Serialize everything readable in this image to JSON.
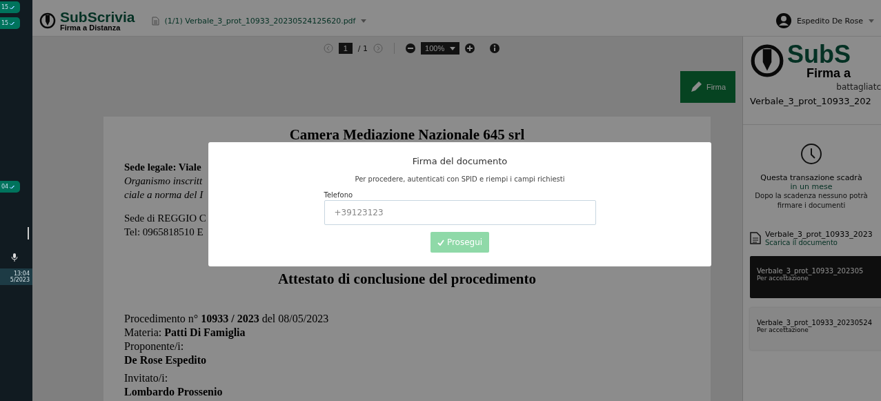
{
  "chat_strip": {
    "bubbles": [
      {
        "time": "15"
      },
      {
        "time": "15"
      },
      {
        "time": "04"
      }
    ],
    "clock": {
      "time": "13:04",
      "date": "5/2023"
    }
  },
  "header": {
    "brand": "SubScrivia",
    "tagline": "Firma a Distanza",
    "file": "(1/1) Verbale_3_prot_10933_20230524125620.pdf",
    "user": "Espedito De Rose"
  },
  "toolbar": {
    "page": "1",
    "page_total": "/ 1",
    "zoom": "100%"
  },
  "sign_button": "Firma",
  "document": {
    "title": "Camera Mediazione Nazionale 645 srl",
    "header_lines": [
      {
        "text": "Sede legale: Viale",
        "kind": "bold"
      },
      {
        "text": "Organismo inscritt",
        "kind": "italic"
      },
      {
        "text": "ciale a norma del I",
        "kind": "italic"
      },
      {
        "text": "Sede di REGGIO C",
        "kind": "gap"
      },
      {
        "text": "Tel: 0965818510 E",
        "kind": "plain"
      }
    ],
    "heading": "Attestato di conclusione del procedimento",
    "body_lines": [
      {
        "text": "Procedimento n° **10933 / 2023** del 08/05/2023",
        "kind": "plain"
      },
      {
        "text": "Materia: **Patti Di Famiglia**",
        "kind": "plain"
      },
      {
        "text": "Proponente/i:",
        "kind": "plain"
      },
      {
        "text": "De Rose Espedito",
        "kind": "bold"
      },
      {
        "text": "Invitato/i:",
        "kind": "gap"
      },
      {
        "text": "Lombardo Prossenio",
        "kind": "bold"
      }
    ]
  },
  "sidebar": {
    "brand": "SubS",
    "tagline": "Firma a",
    "account": "battagliatc",
    "document_name": "Verbale_3_prot_10933_202",
    "expiry": {
      "title": "Questa transazione scadrà",
      "when": "in un mese",
      "note": "Dopo la scadenza nessuno potrà firmare i documenti"
    },
    "file": {
      "name": "Verbale_3_prot_10933_2023",
      "action": "Scarica il documento"
    },
    "cards": [
      {
        "name": "Verbale_3_prot_10933_202305",
        "purpose": "Per accettazione",
        "selected": true
      },
      {
        "name": "Verbale_3_prot_10933_20230524",
        "purpose": "Per accettazione",
        "selected": false
      }
    ]
  },
  "modal": {
    "title": "Firma del documento",
    "message": "Per procedere, autenticati con SPID e riempi i campi richiesti",
    "field_label": "Telefono",
    "field_placeholder": "+39123123",
    "button": "Prosegui",
    "disabled": true
  }
}
